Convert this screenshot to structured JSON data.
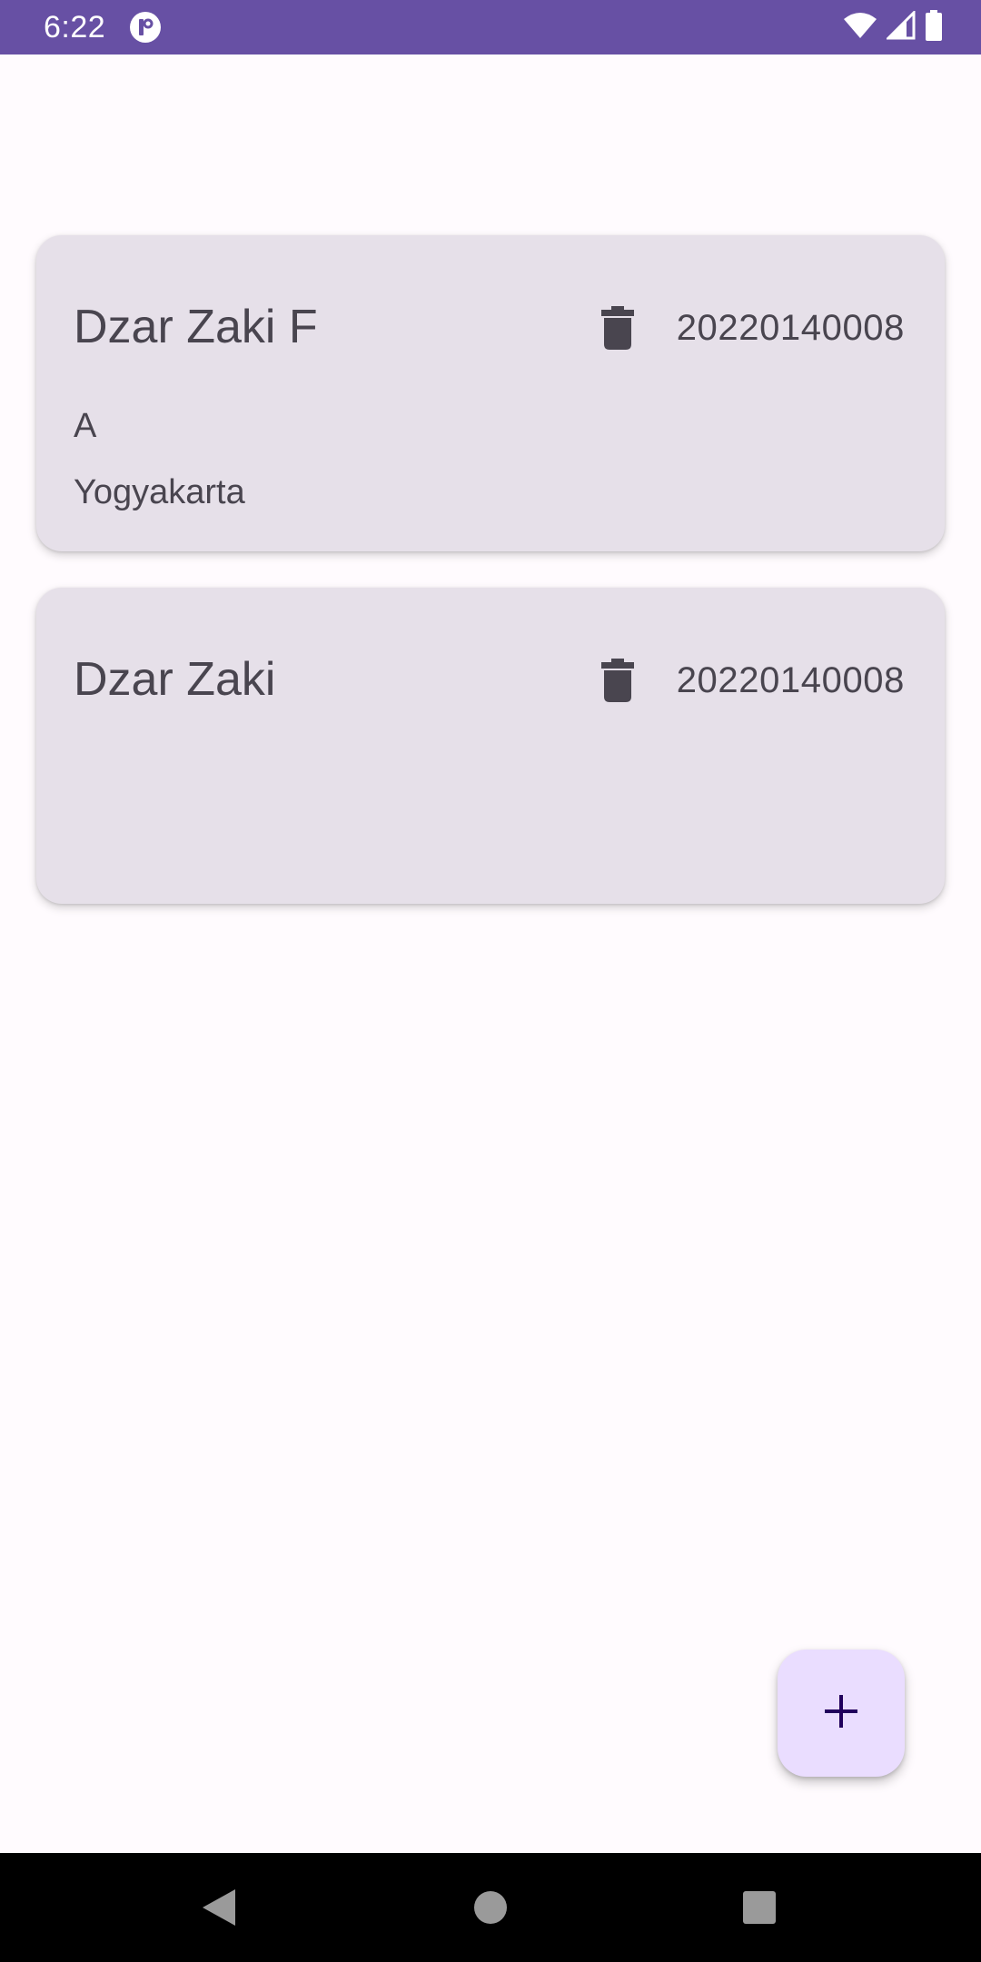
{
  "status_bar": {
    "time": "6:22",
    "app_icon": "notification-app-icon",
    "icons": [
      "wifi-icon",
      "cell-signal-icon",
      "battery-icon"
    ],
    "color": "#6750A4"
  },
  "cards": [
    {
      "name": "Dzar Zaki F",
      "nim": "20220140008",
      "kelas": "A",
      "alamat": "Yogyakarta",
      "delete_icon": "trash-icon"
    },
    {
      "name": "Dzar Zaki",
      "nim": "20220140008",
      "kelas": "",
      "alamat": "",
      "delete_icon": "trash-icon"
    }
  ],
  "fab": {
    "icon": "plus-icon",
    "color": "#EADDFF"
  },
  "nav_bar": {
    "icons": [
      "back-icon",
      "home-icon",
      "recents-icon"
    ]
  },
  "colors": {
    "card_background": "#E6E0E9",
    "text": "#49454F",
    "page_background": "#FFFBFE"
  }
}
